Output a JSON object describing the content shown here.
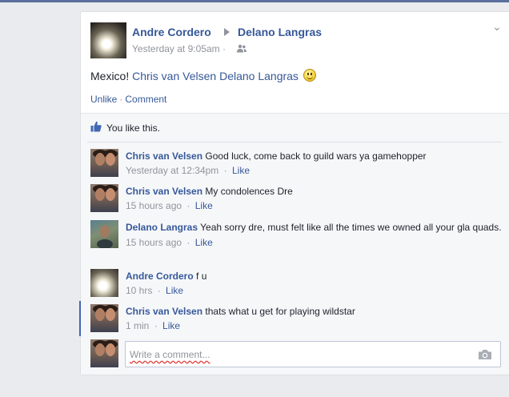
{
  "post": {
    "author": "Andre Cordero",
    "target": "Delano Langras",
    "timestamp": "Yesterday at 9:05am",
    "audience_icon": "friends-icon",
    "text_prefix": "Mexico!",
    "tags": [
      "Chris van Velsen",
      "Delano Langras"
    ],
    "emoji": "smiley-icon",
    "actions": {
      "unlike": "Unlike",
      "comment": "Comment",
      "separator": "·"
    }
  },
  "likes": {
    "text": "You like this."
  },
  "comments": [
    {
      "author": "Chris van Velsen",
      "text": "Good luck, come back to guild wars ya gamehopper",
      "time": "Yesterday at 12:34pm",
      "like": "Like"
    },
    {
      "author": "Chris van Velsen",
      "text": "My condolences Dre",
      "time": "15 hours ago",
      "like": "Like"
    },
    {
      "author": "Delano Langras",
      "text": "Yeah sorry dre, must felt like all the times we owned all your gla quads.",
      "time": "15 hours ago",
      "like": "Like"
    },
    {
      "author": "Andre Cordero",
      "text": "f u",
      "time": "10 hrs",
      "like": "Like"
    },
    {
      "author": "Chris van Velsen",
      "text": "thats what u get for playing wildstar",
      "time": "1 min",
      "like": "Like"
    }
  ],
  "composer": {
    "placeholder": "Write a comment..."
  },
  "colors": {
    "link": "#365899",
    "meta": "#90949c",
    "accent": "#4267b2",
    "background": "#e9ebee"
  }
}
